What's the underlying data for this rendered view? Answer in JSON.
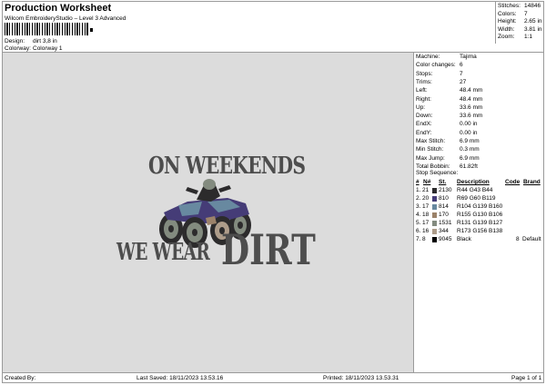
{
  "header": {
    "title": "Production Worksheet",
    "subtitle": "Wilcom EmbroideryStudio – Level 3 Advanced",
    "design_label": "Design:",
    "design_value": "dirt 3,8 in",
    "colorway_label": "Colorway:",
    "colorway_value": "Colorway 1"
  },
  "stats": [
    {
      "label": "Stitches:",
      "value": "14846"
    },
    {
      "label": "Colors:",
      "value": "7"
    },
    {
      "label": "Height:",
      "value": "2.65 in"
    },
    {
      "label": "Width:",
      "value": "3.81 in"
    },
    {
      "label": "Zoom:",
      "value": "1:1"
    }
  ],
  "design_art": {
    "line1": "ON WEEKENDS",
    "line2": "WE WEAR",
    "line3": "DIRT",
    "ink_color": "#4d4d4d",
    "canvas_color": "#dcdcdc"
  },
  "machine_info": [
    {
      "label": "Machine:",
      "value": "Tajima"
    },
    {
      "label": "Color changes:",
      "value": "6"
    },
    {
      "label": "Stops:",
      "value": "7"
    },
    {
      "label": "Trims:",
      "value": "27"
    },
    {
      "label": "Left:",
      "value": "48.4 mm"
    },
    {
      "label": "Right:",
      "value": "48.4 mm"
    },
    {
      "label": "Up:",
      "value": "33.6 mm"
    },
    {
      "label": "Down:",
      "value": "33.6 mm"
    },
    {
      "label": "EndX:",
      "value": "0.00 in"
    },
    {
      "label": "EndY:",
      "value": "0.00 in"
    },
    {
      "label": "Max Stitch:",
      "value": "6.9 mm"
    },
    {
      "label": "Min Stitch:",
      "value": "0.3 mm"
    },
    {
      "label": "Max Jump:",
      "value": "6.9 mm"
    },
    {
      "label": "Total Bobbin:",
      "value": "61.82ft"
    }
  ],
  "stop_sequence": {
    "title": "Stop Sequence:",
    "headers": [
      "#",
      "N#",
      "St.",
      "Description",
      "Code",
      "Brand"
    ],
    "rows": [
      {
        "num": "1.",
        "n": "21",
        "color": "#2c2b2c",
        "st": "2130",
        "desc": "R44 G43 B44",
        "code": "",
        "brand": ""
      },
      {
        "num": "2.",
        "n": "20",
        "color": "#453c77",
        "st": "810",
        "desc": "R69 G60 B119",
        "code": "",
        "brand": ""
      },
      {
        "num": "3.",
        "n": "17",
        "color": "#6889a0",
        "st": "814",
        "desc": "R104 G139 B160",
        "code": "",
        "brand": ""
      },
      {
        "num": "4.",
        "n": "18",
        "color": "#9b826a",
        "st": "170",
        "desc": "R155 G130 B106",
        "code": "",
        "brand": ""
      },
      {
        "num": "5.",
        "n": "17",
        "color": "#838b7f",
        "st": "1531",
        "desc": "R131 G139 B127",
        "code": "",
        "brand": ""
      },
      {
        "num": "6.",
        "n": "16",
        "color": "#ad9c8a",
        "st": "344",
        "desc": "R173 G156 B138",
        "code": "",
        "brand": ""
      },
      {
        "num": "7.",
        "n": "8",
        "color": "#000000",
        "st": "9045",
        "desc": "Black",
        "code": "8",
        "brand": "Default"
      }
    ]
  },
  "footer": {
    "created_by": "Created By:",
    "last_saved": "Last Saved: 18/11/2023 13.53.16",
    "printed": "Printed: 18/11/2023 13.53.31",
    "page": "Page 1 of 1"
  }
}
